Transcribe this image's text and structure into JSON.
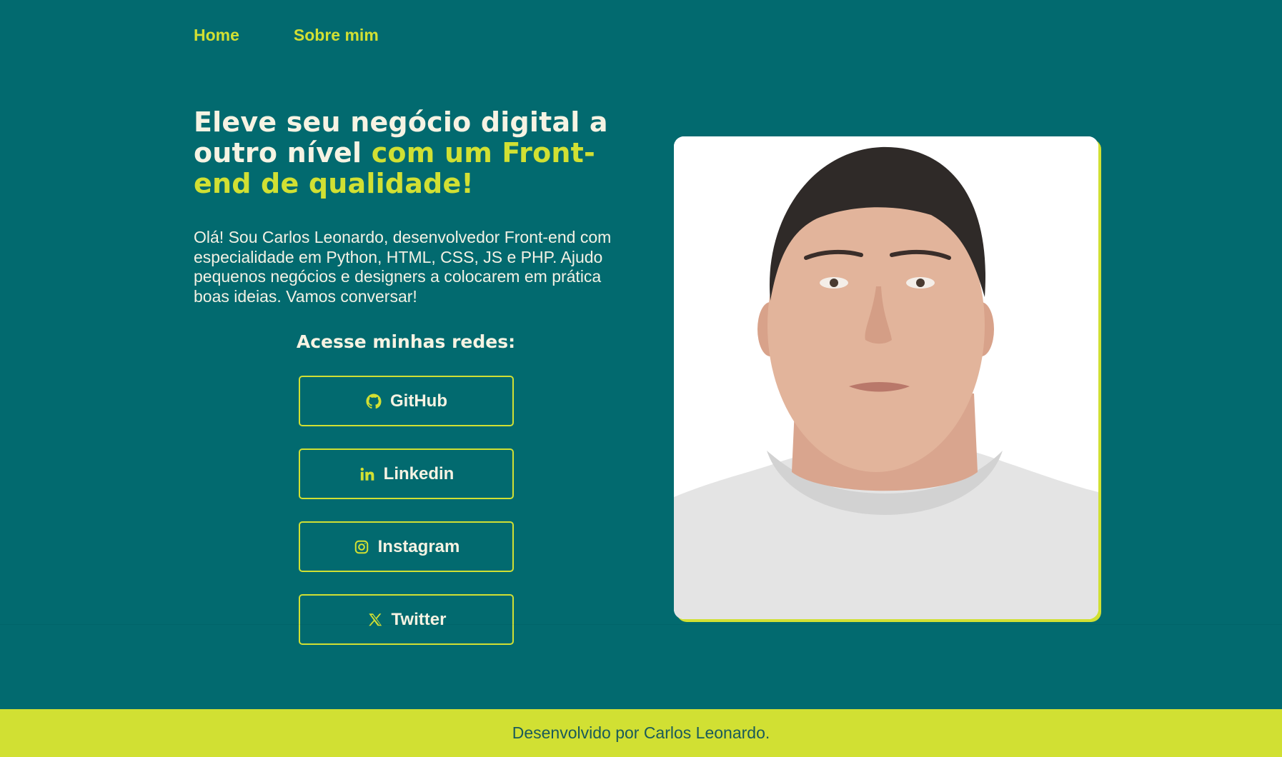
{
  "nav": {
    "items": [
      {
        "label": "Home"
      },
      {
        "label": "Sobre mim"
      }
    ]
  },
  "hero": {
    "title_part1": "Eleve seu negócio digital a outro nível ",
    "title_highlight": "com um Front-end de qualidade!",
    "intro": "Olá! Sou Carlos Leonardo, desenvolvedor Front-end com especialidade em Python, HTML, CSS, JS e PHP. Ajudo pequenos negócios e designers a colocarem em prática boas ideias. Vamos conversar!"
  },
  "networks": {
    "title": "Acesse minhas redes:",
    "links": [
      {
        "label": "GitHub",
        "icon": "github-icon"
      },
      {
        "label": "Linkedin",
        "icon": "linkedin-icon"
      },
      {
        "label": "Instagram",
        "icon": "instagram-icon"
      },
      {
        "label": "Twitter",
        "icon": "x-twitter-icon"
      }
    ]
  },
  "photo": {
    "alt": "Carlos Leonardo"
  },
  "footer": {
    "text": "Desenvolvido por Carlos Leonardo."
  },
  "colors": {
    "background": "#026a6f",
    "accent": "#d1e033",
    "text_light": "#f6f3e3",
    "footer_text": "#1a5a5a"
  }
}
